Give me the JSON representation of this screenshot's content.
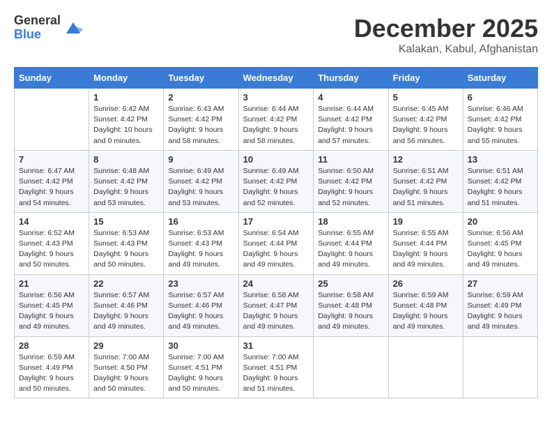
{
  "logo": {
    "general": "General",
    "blue": "Blue"
  },
  "title": "December 2025",
  "location": "Kalakan, Kabul, Afghanistan",
  "headers": [
    "Sunday",
    "Monday",
    "Tuesday",
    "Wednesday",
    "Thursday",
    "Friday",
    "Saturday"
  ],
  "weeks": [
    [
      {
        "day": "",
        "info": ""
      },
      {
        "day": "1",
        "info": "Sunrise: 6:42 AM\nSunset: 4:42 PM\nDaylight: 10 hours\nand 0 minutes."
      },
      {
        "day": "2",
        "info": "Sunrise: 6:43 AM\nSunset: 4:42 PM\nDaylight: 9 hours\nand 58 minutes."
      },
      {
        "day": "3",
        "info": "Sunrise: 6:44 AM\nSunset: 4:42 PM\nDaylight: 9 hours\nand 58 minutes."
      },
      {
        "day": "4",
        "info": "Sunrise: 6:44 AM\nSunset: 4:42 PM\nDaylight: 9 hours\nand 57 minutes."
      },
      {
        "day": "5",
        "info": "Sunrise: 6:45 AM\nSunset: 4:42 PM\nDaylight: 9 hours\nand 56 minutes."
      },
      {
        "day": "6",
        "info": "Sunrise: 6:46 AM\nSunset: 4:42 PM\nDaylight: 9 hours\nand 55 minutes."
      }
    ],
    [
      {
        "day": "7",
        "info": "Sunrise: 6:47 AM\nSunset: 4:42 PM\nDaylight: 9 hours\nand 54 minutes."
      },
      {
        "day": "8",
        "info": "Sunrise: 6:48 AM\nSunset: 4:42 PM\nDaylight: 9 hours\nand 53 minutes."
      },
      {
        "day": "9",
        "info": "Sunrise: 6:49 AM\nSunset: 4:42 PM\nDaylight: 9 hours\nand 53 minutes."
      },
      {
        "day": "10",
        "info": "Sunrise: 6:49 AM\nSunset: 4:42 PM\nDaylight: 9 hours\nand 52 minutes."
      },
      {
        "day": "11",
        "info": "Sunrise: 6:50 AM\nSunset: 4:42 PM\nDaylight: 9 hours\nand 52 minutes."
      },
      {
        "day": "12",
        "info": "Sunrise: 6:51 AM\nSunset: 4:42 PM\nDaylight: 9 hours\nand 51 minutes."
      },
      {
        "day": "13",
        "info": "Sunrise: 6:51 AM\nSunset: 4:42 PM\nDaylight: 9 hours\nand 51 minutes."
      }
    ],
    [
      {
        "day": "14",
        "info": "Sunrise: 6:52 AM\nSunset: 4:43 PM\nDaylight: 9 hours\nand 50 minutes."
      },
      {
        "day": "15",
        "info": "Sunrise: 6:53 AM\nSunset: 4:43 PM\nDaylight: 9 hours\nand 50 minutes."
      },
      {
        "day": "16",
        "info": "Sunrise: 6:53 AM\nSunset: 4:43 PM\nDaylight: 9 hours\nand 49 minutes."
      },
      {
        "day": "17",
        "info": "Sunrise: 6:54 AM\nSunset: 4:44 PM\nDaylight: 9 hours\nand 49 minutes."
      },
      {
        "day": "18",
        "info": "Sunrise: 6:55 AM\nSunset: 4:44 PM\nDaylight: 9 hours\nand 49 minutes."
      },
      {
        "day": "19",
        "info": "Sunrise: 6:55 AM\nSunset: 4:44 PM\nDaylight: 9 hours\nand 49 minutes."
      },
      {
        "day": "20",
        "info": "Sunrise: 6:56 AM\nSunset: 4:45 PM\nDaylight: 9 hours\nand 49 minutes."
      }
    ],
    [
      {
        "day": "21",
        "info": "Sunrise: 6:56 AM\nSunset: 4:45 PM\nDaylight: 9 hours\nand 49 minutes."
      },
      {
        "day": "22",
        "info": "Sunrise: 6:57 AM\nSunset: 4:46 PM\nDaylight: 9 hours\nand 49 minutes."
      },
      {
        "day": "23",
        "info": "Sunrise: 6:57 AM\nSunset: 4:46 PM\nDaylight: 9 hours\nand 49 minutes."
      },
      {
        "day": "24",
        "info": "Sunrise: 6:58 AM\nSunset: 4:47 PM\nDaylight: 9 hours\nand 49 minutes."
      },
      {
        "day": "25",
        "info": "Sunrise: 6:58 AM\nSunset: 4:48 PM\nDaylight: 9 hours\nand 49 minutes."
      },
      {
        "day": "26",
        "info": "Sunrise: 6:59 AM\nSunset: 4:48 PM\nDaylight: 9 hours\nand 49 minutes."
      },
      {
        "day": "27",
        "info": "Sunrise: 6:59 AM\nSunset: 4:49 PM\nDaylight: 9 hours\nand 49 minutes."
      }
    ],
    [
      {
        "day": "28",
        "info": "Sunrise: 6:59 AM\nSunset: 4:49 PM\nDaylight: 9 hours\nand 50 minutes."
      },
      {
        "day": "29",
        "info": "Sunrise: 7:00 AM\nSunset: 4:50 PM\nDaylight: 9 hours\nand 50 minutes."
      },
      {
        "day": "30",
        "info": "Sunrise: 7:00 AM\nSunset: 4:51 PM\nDaylight: 9 hours\nand 50 minutes."
      },
      {
        "day": "31",
        "info": "Sunrise: 7:00 AM\nSunset: 4:51 PM\nDaylight: 9 hours\nand 51 minutes."
      },
      {
        "day": "",
        "info": ""
      },
      {
        "day": "",
        "info": ""
      },
      {
        "day": "",
        "info": ""
      }
    ]
  ]
}
